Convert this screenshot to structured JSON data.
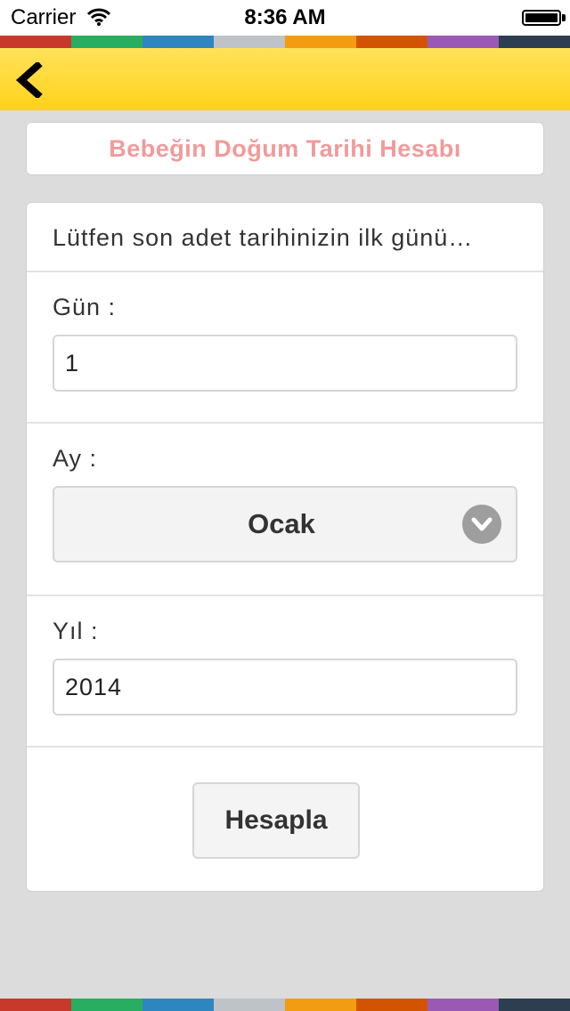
{
  "status_bar": {
    "carrier": "Carrier",
    "time": "8:36 AM",
    "wifi_icon": "wifi-icon",
    "battery_icon": "battery-icon"
  },
  "stripe_colors": [
    "#c8392b",
    "#27ae60",
    "#2e86c1",
    "#bdc3c7",
    "#f39c12",
    "#d35400",
    "#9b59b6",
    "#2c3e50"
  ],
  "navbar": {
    "background": "#ffd21a",
    "back_icon": "chevron-left-icon"
  },
  "title_card": {
    "title": "Bebeğin Doğum Tarihi Hesabı",
    "title_color": "#f19a9a"
  },
  "form": {
    "prompt": "Lütfen son adet tarihinizin ilk günü…",
    "day": {
      "label": "Gün :",
      "value": "1"
    },
    "month": {
      "label": "Ay :",
      "selected": "Ocak",
      "icon": "chevron-down-icon"
    },
    "year": {
      "label": "Yıl :",
      "value": "2014"
    },
    "submit_label": "Hesapla"
  }
}
